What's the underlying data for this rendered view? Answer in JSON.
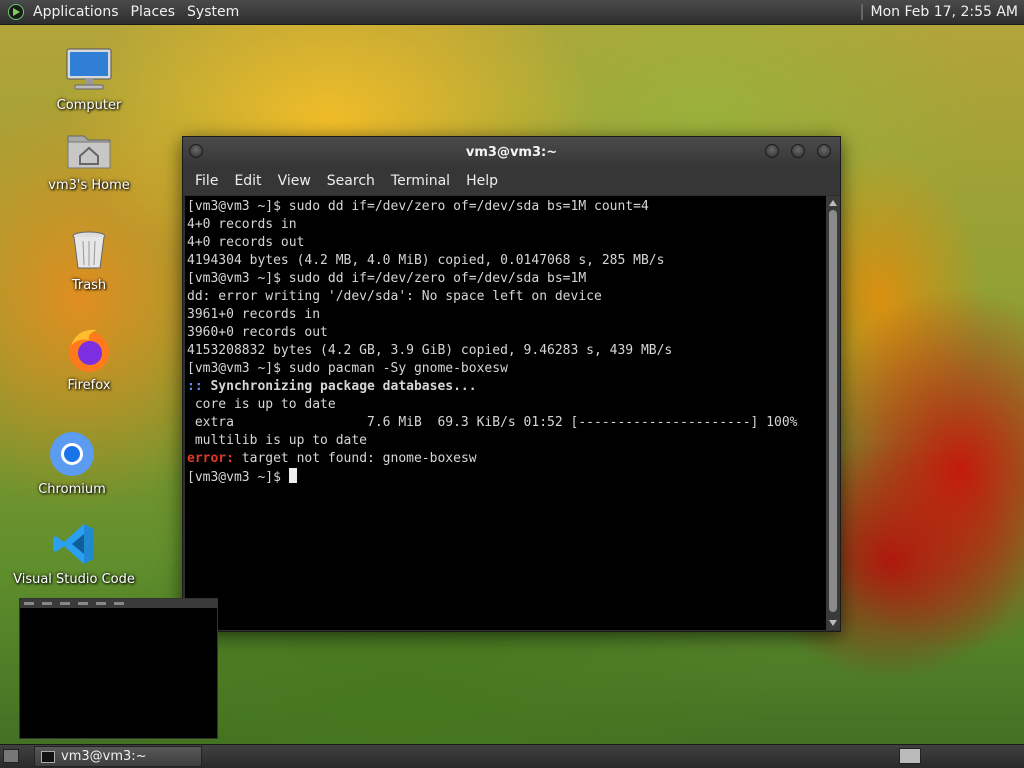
{
  "top_panel": {
    "menus": [
      "Applications",
      "Places",
      "System"
    ],
    "clock": "Mon Feb 17,  2:55 AM"
  },
  "desktop_icons": [
    {
      "label": "Computer",
      "icon": "computer-icon"
    },
    {
      "label": "vm3's Home",
      "icon": "home-folder-icon"
    },
    {
      "label": "Trash",
      "icon": "trash-icon"
    },
    {
      "label": "Firefox",
      "icon": "firefox-icon"
    },
    {
      "label": "Chromium",
      "icon": "chromium-icon"
    },
    {
      "label": "Visual Studio Code",
      "icon": "vscode-icon"
    }
  ],
  "terminal": {
    "title": "vm3@vm3:~",
    "menu": [
      "File",
      "Edit",
      "View",
      "Search",
      "Terminal",
      "Help"
    ],
    "lines": [
      "[vm3@vm3 ~]$ sudo dd if=/dev/zero of=/dev/sda bs=1M count=4",
      "4+0 records in",
      "4+0 records out",
      "4194304 bytes (4.2 MB, 4.0 MiB) copied, 0.0147068 s, 285 MB/s",
      "[vm3@vm3 ~]$ sudo dd if=/dev/zero of=/dev/sda bs=1M",
      "dd: error writing '/dev/sda': No space left on device",
      "3961+0 records in",
      "3960+0 records out",
      "4153208832 bytes (4.2 GB, 3.9 GiB) copied, 9.46283 s, 439 MB/s",
      "[vm3@vm3 ~]$ sudo pacman -Sy gnome-boxesw"
    ],
    "sync_prefix": "::",
    "sync_text": " Synchronizing package databases...",
    "sync_lines": [
      " core is up to date",
      " extra                 7.6 MiB  69.3 KiB/s 01:52 [----------------------] 100%",
      " multilib is up to date"
    ],
    "error_prefix": "error:",
    "error_text": " target not found: gnome-boxesw",
    "prompt": "[vm3@vm3 ~]$ "
  },
  "taskbar": {
    "window_label": "vm3@vm3:~"
  },
  "colors": {
    "panel": "#2e2e2e",
    "terminal_bg": "#000000",
    "sync_prefix": "#5d8ff0",
    "error": "#e0362c"
  }
}
